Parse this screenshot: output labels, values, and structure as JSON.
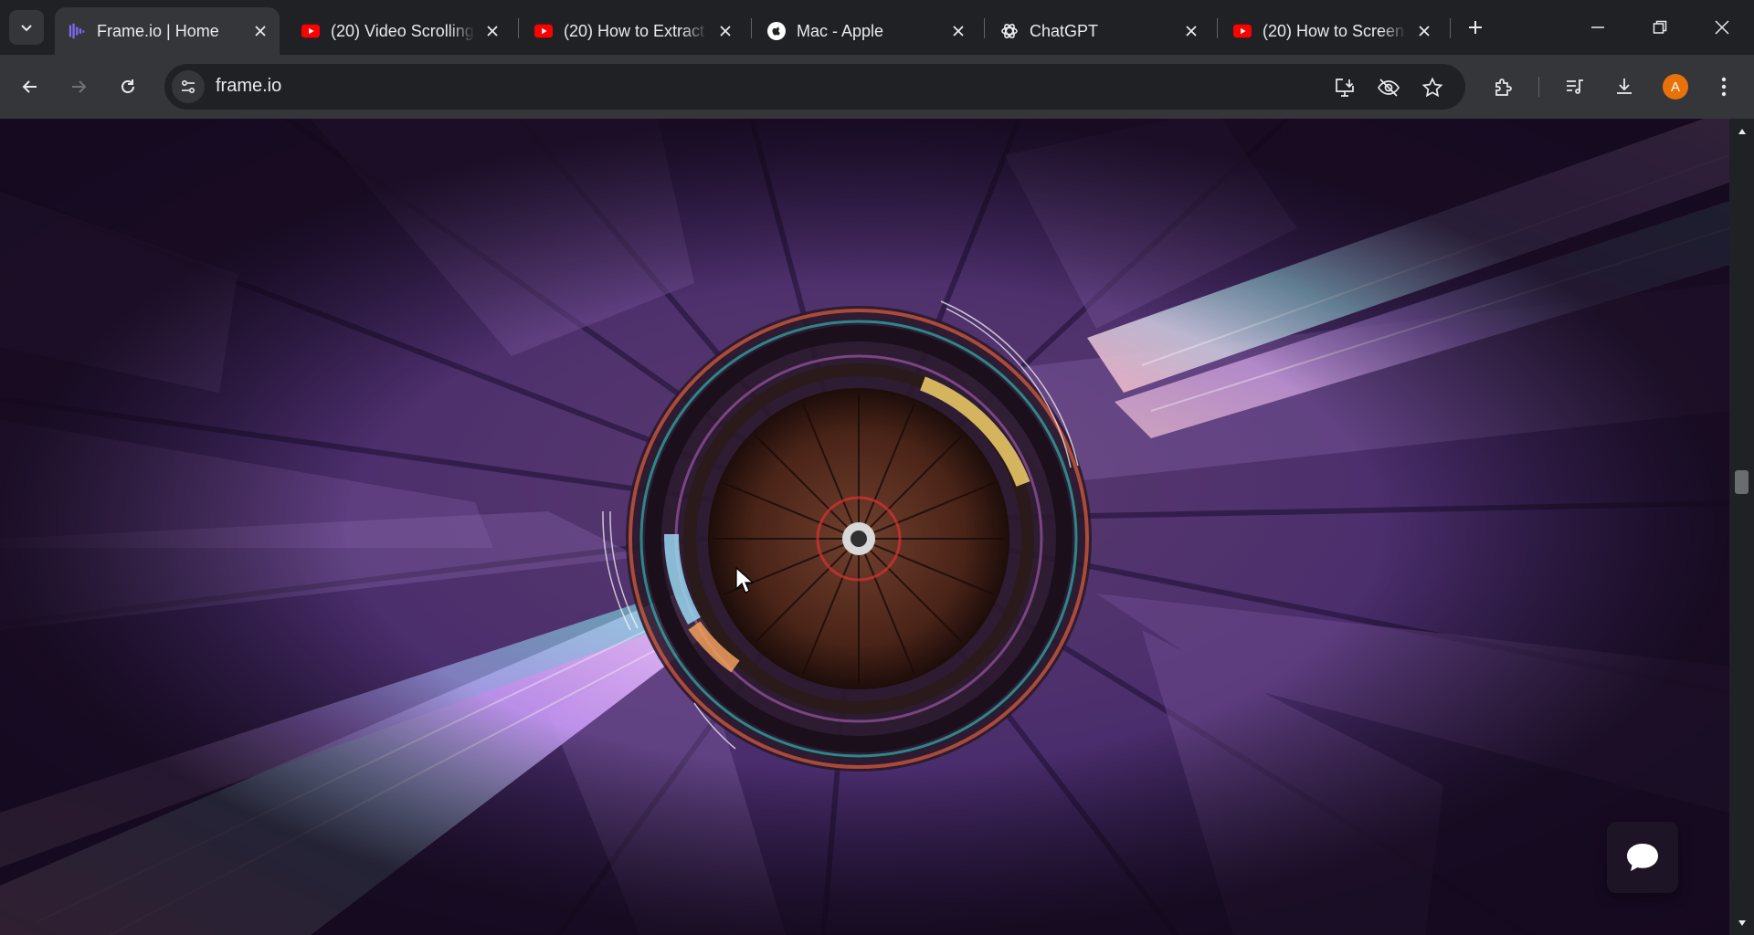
{
  "browser": {
    "tabs": [
      {
        "title": "Frame.io | Home",
        "favicon": "frameio-logo-icon",
        "active": true
      },
      {
        "title": "(20) Video Scrolling",
        "favicon": "youtube-icon",
        "active": false
      },
      {
        "title": "(20) How to Extract",
        "favicon": "youtube-icon",
        "active": false
      },
      {
        "title": "Mac - Apple",
        "favicon": "apple-icon",
        "active": false
      },
      {
        "title": "ChatGPT",
        "favicon": "chatgpt-icon",
        "active": false
      },
      {
        "title": "(20) How to Screen",
        "favicon": "youtube-icon",
        "active": false
      }
    ],
    "address_bar": {
      "url": "frame.io"
    },
    "profile": {
      "initial": "A",
      "color": "#e8710a"
    }
  },
  "page": {
    "hero": {
      "description_icon": "particle-tunnel-hero-video"
    },
    "chat_button": {
      "icon": "chat-bubble-icon"
    }
  },
  "colors": {
    "accent_youtube": "#ff0000",
    "tab_active_bg": "#35363a",
    "frameio_purple": "#7c6cf6"
  }
}
